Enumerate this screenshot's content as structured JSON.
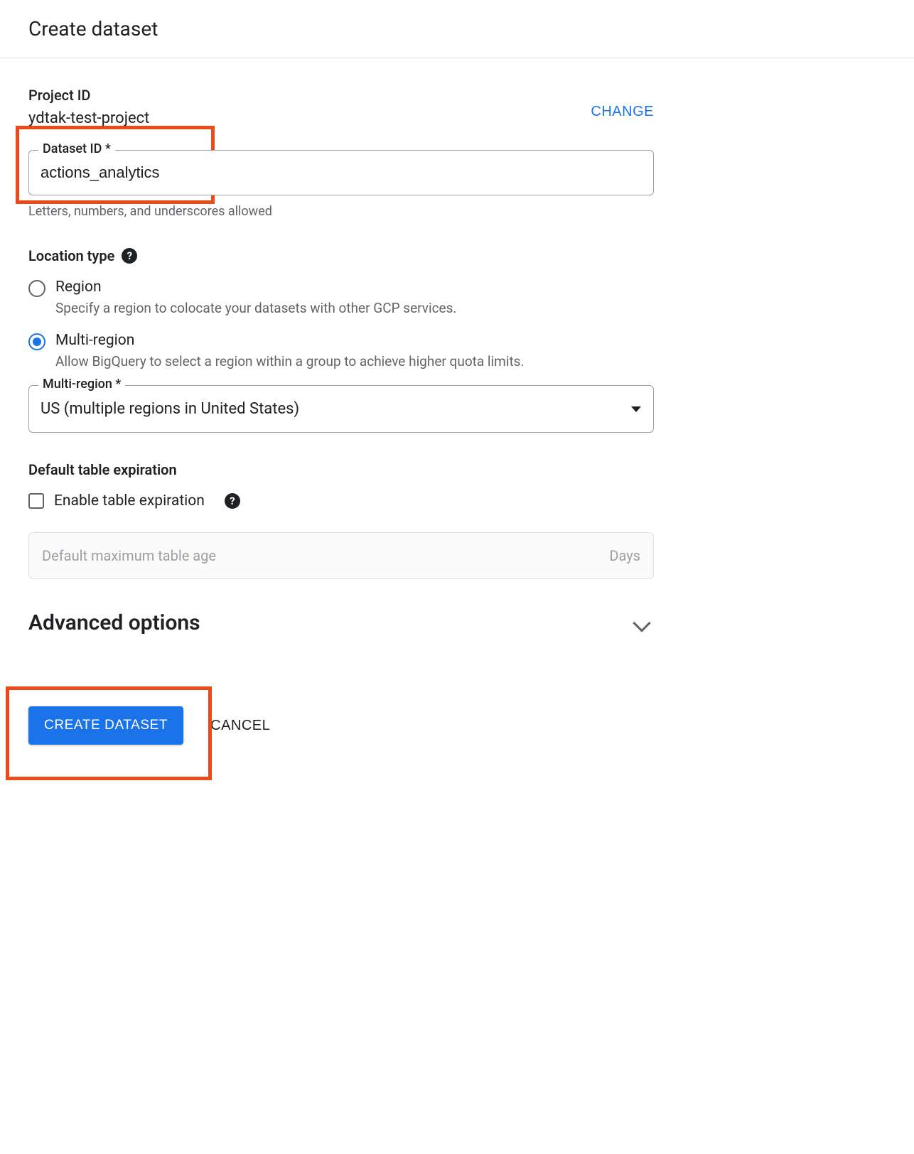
{
  "title": "Create dataset",
  "project": {
    "label": "Project ID",
    "value": "ydtak-test-project",
    "change_label": "CHANGE"
  },
  "dataset_id": {
    "legend": "Dataset ID *",
    "value": "actions_analytics",
    "helper": "Letters, numbers, and underscores allowed"
  },
  "location_type": {
    "heading": "Location type",
    "options": [
      {
        "label": "Region",
        "desc": "Specify a region to colocate your datasets with other GCP services.",
        "selected": false
      },
      {
        "label": "Multi-region",
        "desc": "Allow BigQuery to select a region within a group to achieve higher quota limits.",
        "selected": true
      }
    ]
  },
  "multi_region": {
    "legend": "Multi-region *",
    "value": "US (multiple regions in United States)"
  },
  "expiration": {
    "heading": "Default table expiration",
    "checkbox_label": "Enable table expiration",
    "table_age_placeholder": "Default maximum table age",
    "table_age_unit": "Days"
  },
  "advanced": {
    "heading": "Advanced options"
  },
  "actions": {
    "create_label": "CREATE DATASET",
    "cancel_label": "CANCEL"
  }
}
